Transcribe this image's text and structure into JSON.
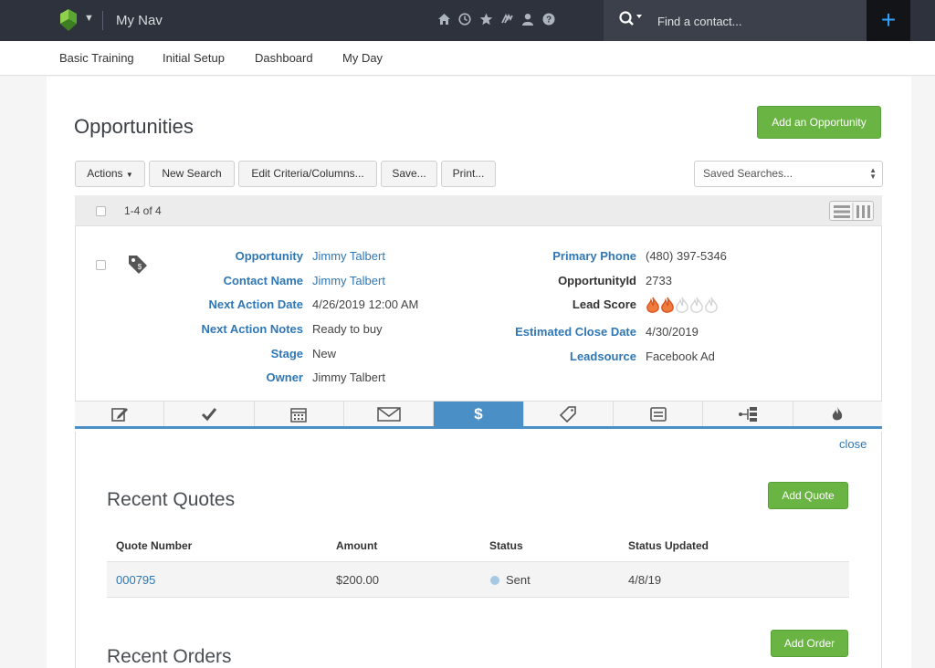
{
  "topbar": {
    "nav_title": "My Nav",
    "search_placeholder": "Find a contact...",
    "add_label": "+",
    "icons": [
      "home-icon",
      "clock-icon",
      "star-icon",
      "swap-icon",
      "user-icon",
      "help-icon"
    ]
  },
  "subnav": {
    "items": [
      "Basic Training",
      "Initial Setup",
      "Dashboard",
      "My Day"
    ]
  },
  "page": {
    "title": "Opportunities",
    "add_button": "Add an Opportunity"
  },
  "toolbar": {
    "actions": "Actions",
    "new_search": "New Search",
    "edit_criteria": "Edit Criteria/Columns...",
    "save": "Save...",
    "print": "Print...",
    "saved_searches": "Saved Searches..."
  },
  "results": {
    "count": "1-4 of 4"
  },
  "record": {
    "left": [
      {
        "label": "Opportunity",
        "value": "Jimmy Talbert"
      },
      {
        "label": "Contact Name",
        "value": "Jimmy Talbert"
      },
      {
        "label": "Next Action Date",
        "value": "4/26/2019 12:00 AM"
      },
      {
        "label": "Next Action Notes",
        "value": "Ready to buy"
      },
      {
        "label": "Stage",
        "value": "New"
      },
      {
        "label": "Owner",
        "value": "Jimmy Talbert"
      }
    ],
    "right": [
      {
        "label": "Primary Phone",
        "value": "(480) 397-5346"
      },
      {
        "label": "OpportunityId",
        "value": "2733"
      },
      {
        "label": "Lead Score",
        "value": ""
      },
      {
        "label": "Estimated Close Date",
        "value": "4/30/2019"
      },
      {
        "label": "Leadsource",
        "value": "Facebook Ad"
      }
    ],
    "lead_score": {
      "filled": 2,
      "total": 5
    }
  },
  "tabs": [
    "edit-note-icon",
    "checkmark-icon",
    "calendar-icon",
    "envelope-icon",
    "dollar-icon",
    "tag-icon",
    "document-icon",
    "hierarchy-icon",
    "flame-icon"
  ],
  "subpanel": {
    "close": "close",
    "quotes_title": "Recent Quotes",
    "add_quote": "Add Quote",
    "quote_headers": [
      "Quote Number",
      "Amount",
      "Status",
      "Status Updated"
    ],
    "quote_rows": [
      {
        "number": "000795",
        "amount": "$200.00",
        "status": "Sent",
        "updated": "4/8/19"
      }
    ],
    "orders_title": "Recent Orders",
    "add_order": "Add Order"
  },
  "colors": {
    "accent_green": "#6ab443",
    "link_blue": "#2f77b5",
    "active_tab": "#4a90c6",
    "topbar": "#2d323c",
    "flame_active": "#f07b3f",
    "flame_inactive": "#d4d4d4"
  }
}
